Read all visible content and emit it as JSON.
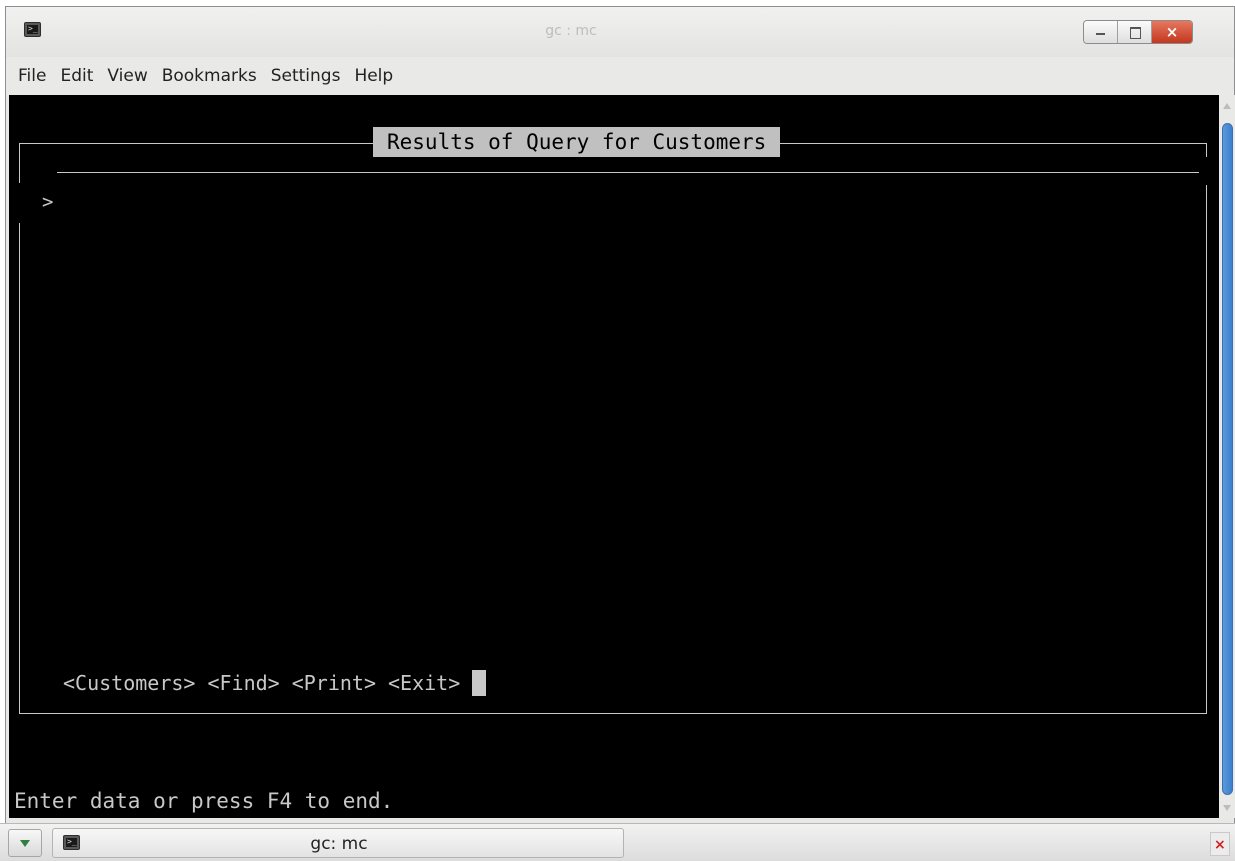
{
  "window": {
    "title": "gc : mc",
    "close_symbol": "×"
  },
  "menu": [
    "File",
    "Edit",
    "View",
    "Bookmarks",
    "Settings",
    "Help"
  ],
  "terminal": {
    "box_title": "Results of Query for Customers",
    "prompt": ">",
    "commands": [
      "<Customers>",
      "<Find>",
      "<Print>",
      "<Exit>"
    ],
    "status": "Enter data or press F4 to end."
  },
  "taskbar": {
    "task_label": "gc: mc",
    "tray_symbol": "×"
  },
  "icons": {
    "app": "terminal-icon",
    "taskbar_menu": "chevron-down-icon",
    "tray": "close-icon"
  }
}
